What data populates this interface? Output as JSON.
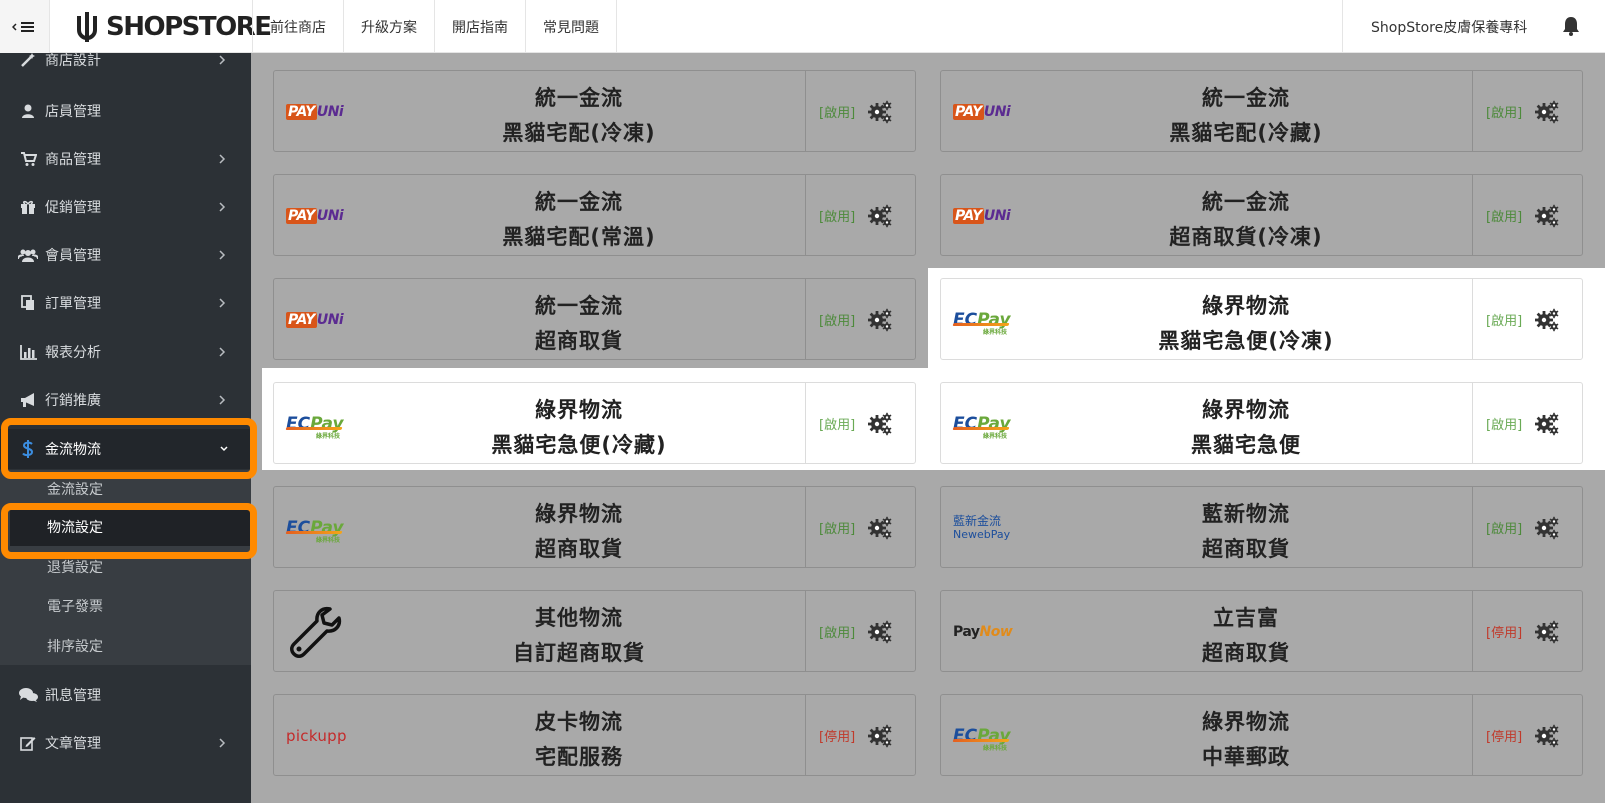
{
  "topbar": {
    "menu_icon": "hamburger-collapse-icon",
    "logo_text": "SHOPSTORE",
    "nav": [
      "前往商店",
      "升級方案",
      "開店指南",
      "常見問題"
    ],
    "store_name": "ShopStore皮膚保養專科",
    "bell_icon": "bell-icon"
  },
  "sidebar": {
    "items": [
      {
        "label": "商店設計",
        "icon": "magic-wand-icon",
        "has_arrow": true
      },
      {
        "label": "店員管理",
        "icon": "user-icon",
        "has_arrow": false
      },
      {
        "label": "商品管理",
        "icon": "cart-icon",
        "has_arrow": true
      },
      {
        "label": "促銷管理",
        "icon": "gift-icon",
        "has_arrow": true
      },
      {
        "label": "會員管理",
        "icon": "users-icon",
        "has_arrow": true
      },
      {
        "label": "訂單管理",
        "icon": "copy-icon",
        "has_arrow": true
      },
      {
        "label": "報表分析",
        "icon": "bar-chart-icon",
        "has_arrow": true
      },
      {
        "label": "行銷推廣",
        "icon": "bullhorn-icon",
        "has_arrow": true
      },
      {
        "label": "金流物流",
        "icon": "dollar-icon",
        "has_arrow": true,
        "expanded": true
      },
      {
        "label": "訊息管理",
        "icon": "comments-icon",
        "has_arrow": false
      },
      {
        "label": "文章管理",
        "icon": "edit-icon",
        "has_arrow": true
      }
    ],
    "submenu": [
      "金流設定",
      "物流設定",
      "退貨設定",
      "電子發票",
      "排序設定"
    ],
    "active_submenu": "物流設定"
  },
  "cards": [
    {
      "logo": "payuni",
      "line1": "統一金流",
      "line2": "黑貓宅配(冷凍)",
      "status": "[啟用]",
      "enabled": true
    },
    {
      "logo": "payuni",
      "line1": "統一金流",
      "line2": "黑貓宅配(冷藏)",
      "status": "[啟用]",
      "enabled": true
    },
    {
      "logo": "payuni",
      "line1": "統一金流",
      "line2": "黑貓宅配(常溫)",
      "status": "[啟用]",
      "enabled": true
    },
    {
      "logo": "payuni",
      "line1": "統一金流",
      "line2": "超商取貨(冷凍)",
      "status": "[啟用]",
      "enabled": true
    },
    {
      "logo": "payuni",
      "line1": "統一金流",
      "line2": "超商取貨",
      "status": "[啟用]",
      "enabled": true
    },
    {
      "logo": "ecpay",
      "line1": "綠界物流",
      "line2": "黑貓宅急便(冷凍)",
      "status": "[啟用]",
      "enabled": true
    },
    {
      "logo": "ecpay",
      "line1": "綠界物流",
      "line2": "黑貓宅急便(冷藏)",
      "status": "[啟用]",
      "enabled": true
    },
    {
      "logo": "ecpay",
      "line1": "綠界物流",
      "line2": "黑貓宅急便",
      "status": "[啟用]",
      "enabled": true
    },
    {
      "logo": "ecpay",
      "line1": "綠界物流",
      "line2": "超商取貨",
      "status": "[啟用]",
      "enabled": true
    },
    {
      "logo": "newebpay",
      "line1": "藍新物流",
      "line2": "超商取貨",
      "status": "[啟用]",
      "enabled": true
    },
    {
      "logo": "wrench",
      "line1": "其他物流",
      "line2": "自訂超商取貨",
      "status": "[啟用]",
      "enabled": true
    },
    {
      "logo": "paynow",
      "line1": "立吉富",
      "line2": "超商取貨",
      "status": "[停用]",
      "enabled": false
    },
    {
      "logo": "pickupp",
      "line1": "皮卡物流",
      "line2": "宅配服務",
      "status": "[停用]",
      "enabled": false
    },
    {
      "logo": "ecpay",
      "line1": "綠界物流",
      "line2": "中華郵政",
      "status": "[停用]",
      "enabled": false
    }
  ],
  "logos": {
    "payuni": {
      "part1": "PAY",
      "part2": "UNi"
    },
    "ecpay": {
      "part1": "EC",
      "part2": "Pay",
      "sub": "綠界科技"
    },
    "newebpay": {
      "line1": "藍新金流",
      "line2": "NewebPay"
    },
    "paynow": {
      "part1": "Pay",
      "part2": "Now"
    },
    "pickupp": {
      "text": "pickupp"
    }
  },
  "colors": {
    "highlight": "#ff8a00",
    "sidebar_bg": "#2c3136",
    "enabled": "#4d8a3b",
    "disabled": "#c03a2b"
  }
}
